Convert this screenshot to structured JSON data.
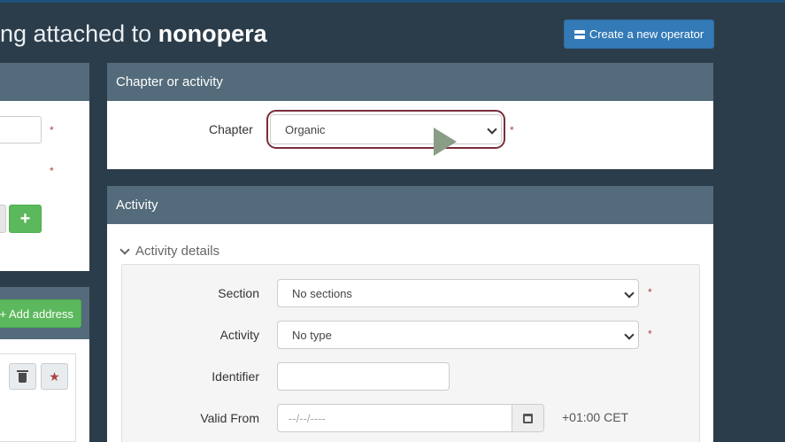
{
  "header": {
    "title_prefix": "ng attached to ",
    "title_bold": "nonopera",
    "create_button_label": "Create a new operator"
  },
  "left_panel": {
    "required_marks": [
      "*",
      "*"
    ],
    "plus_label": "+",
    "add_address_label": "+ Add address"
  },
  "chapter_panel": {
    "heading": "Chapter or activity",
    "chapter_label": "Chapter",
    "chapter_value": "Organic",
    "required_mark": "*"
  },
  "activity_panel": {
    "heading": "Activity",
    "details_toggle_label": "Activity details",
    "fields": {
      "section_label": "Section",
      "section_value": "No sections",
      "activity_label": "Activity",
      "activity_value": "No type",
      "identifier_label": "Identifier",
      "identifier_value": "",
      "valid_from_label": "Valid From",
      "valid_from_placeholder": "--/--/----",
      "timezone": "+01:00 CET"
    },
    "required_mark": "*"
  },
  "colors": {
    "page_bg": "#2b3d4a",
    "panel_header": "#536b7a",
    "primary": "#337ab7",
    "success": "#5cb85c",
    "focus_ring": "#7a2e3a"
  }
}
